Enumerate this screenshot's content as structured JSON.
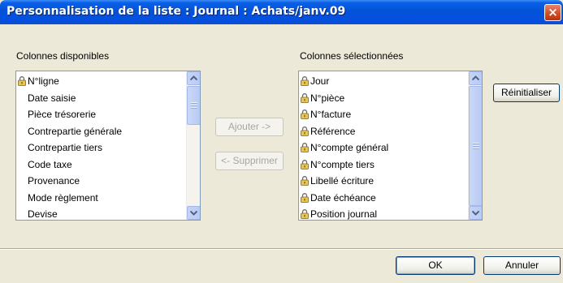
{
  "window": {
    "title": "Personnalisation de la liste : Journal : Achats/janv.09",
    "close_glyph": "×"
  },
  "available": {
    "label": "Colonnes disponibles",
    "items": [
      {
        "text": "N°ligne",
        "locked": true
      },
      {
        "text": "Date saisie",
        "locked": false
      },
      {
        "text": "Pièce trésorerie",
        "locked": false
      },
      {
        "text": "Contrepartie générale",
        "locked": false
      },
      {
        "text": "Contrepartie tiers",
        "locked": false
      },
      {
        "text": "Code taxe",
        "locked": false
      },
      {
        "text": "Provenance",
        "locked": false
      },
      {
        "text": "Mode règlement",
        "locked": false
      },
      {
        "text": "Devise",
        "locked": false
      }
    ]
  },
  "selected": {
    "label": "Colonnes sélectionnées",
    "items": [
      {
        "text": "Jour",
        "locked": true
      },
      {
        "text": "N°pièce",
        "locked": true
      },
      {
        "text": "N°facture",
        "locked": true
      },
      {
        "text": "Référence",
        "locked": true
      },
      {
        "text": "N°compte général",
        "locked": true
      },
      {
        "text": "N°compte tiers",
        "locked": true
      },
      {
        "text": "Libellé écriture",
        "locked": true
      },
      {
        "text": "Date échéance",
        "locked": true
      },
      {
        "text": "Position journal",
        "locked": true
      }
    ]
  },
  "buttons": {
    "add": "Ajouter ->",
    "remove": "<- Supprimer",
    "reset": "Réinitialiser",
    "ok": "OK",
    "cancel": "Annuler"
  },
  "icons": {
    "lock": "padlock-icon",
    "scroll_up": "chevron-up-icon",
    "scroll_down": "chevron-down-icon",
    "close": "close-icon"
  }
}
